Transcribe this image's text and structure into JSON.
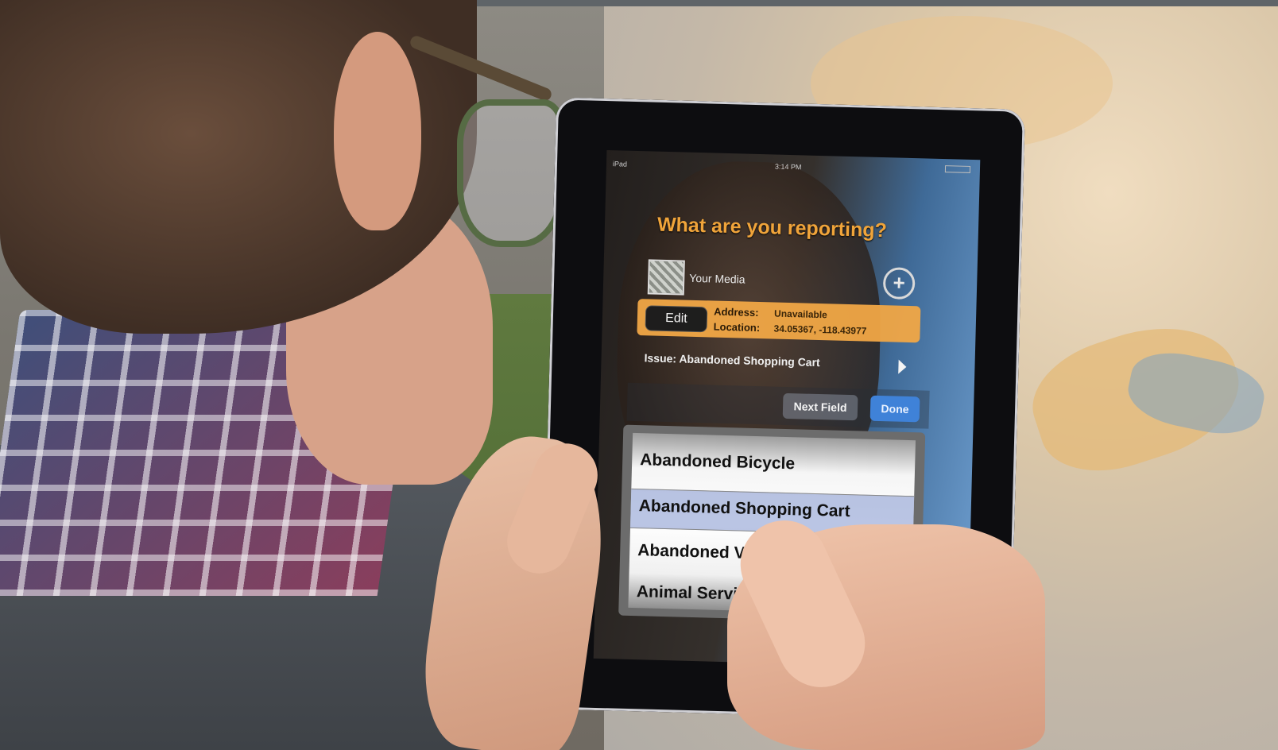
{
  "ipad_screen": {
    "status_bar": {
      "device": "iPad",
      "time": "3:14 PM"
    },
    "title": "What are you reporting?",
    "media": {
      "label": "Your Media",
      "add_button": "+"
    },
    "location_bar": {
      "edit_label": "Edit",
      "address_key": "Address:",
      "address_value": "Unavailable",
      "location_key": "Location:",
      "location_value": "34.05367, -118.43977"
    },
    "issue": {
      "text": "Issue: Abandoned Shopping Cart"
    },
    "toolbar": {
      "next_label": "Next Field",
      "done_label": "Done"
    },
    "picker": {
      "rows": [
        "Abandoned Bicycle",
        "Abandoned Shopping Cart",
        "Abandoned Vehicle",
        "Animal Services"
      ],
      "selected": "Abandoned Shopping Cart"
    },
    "colors": {
      "title": "#f0a43a",
      "location_bar": "#f1a746",
      "done_button": "#3f82d8"
    }
  }
}
